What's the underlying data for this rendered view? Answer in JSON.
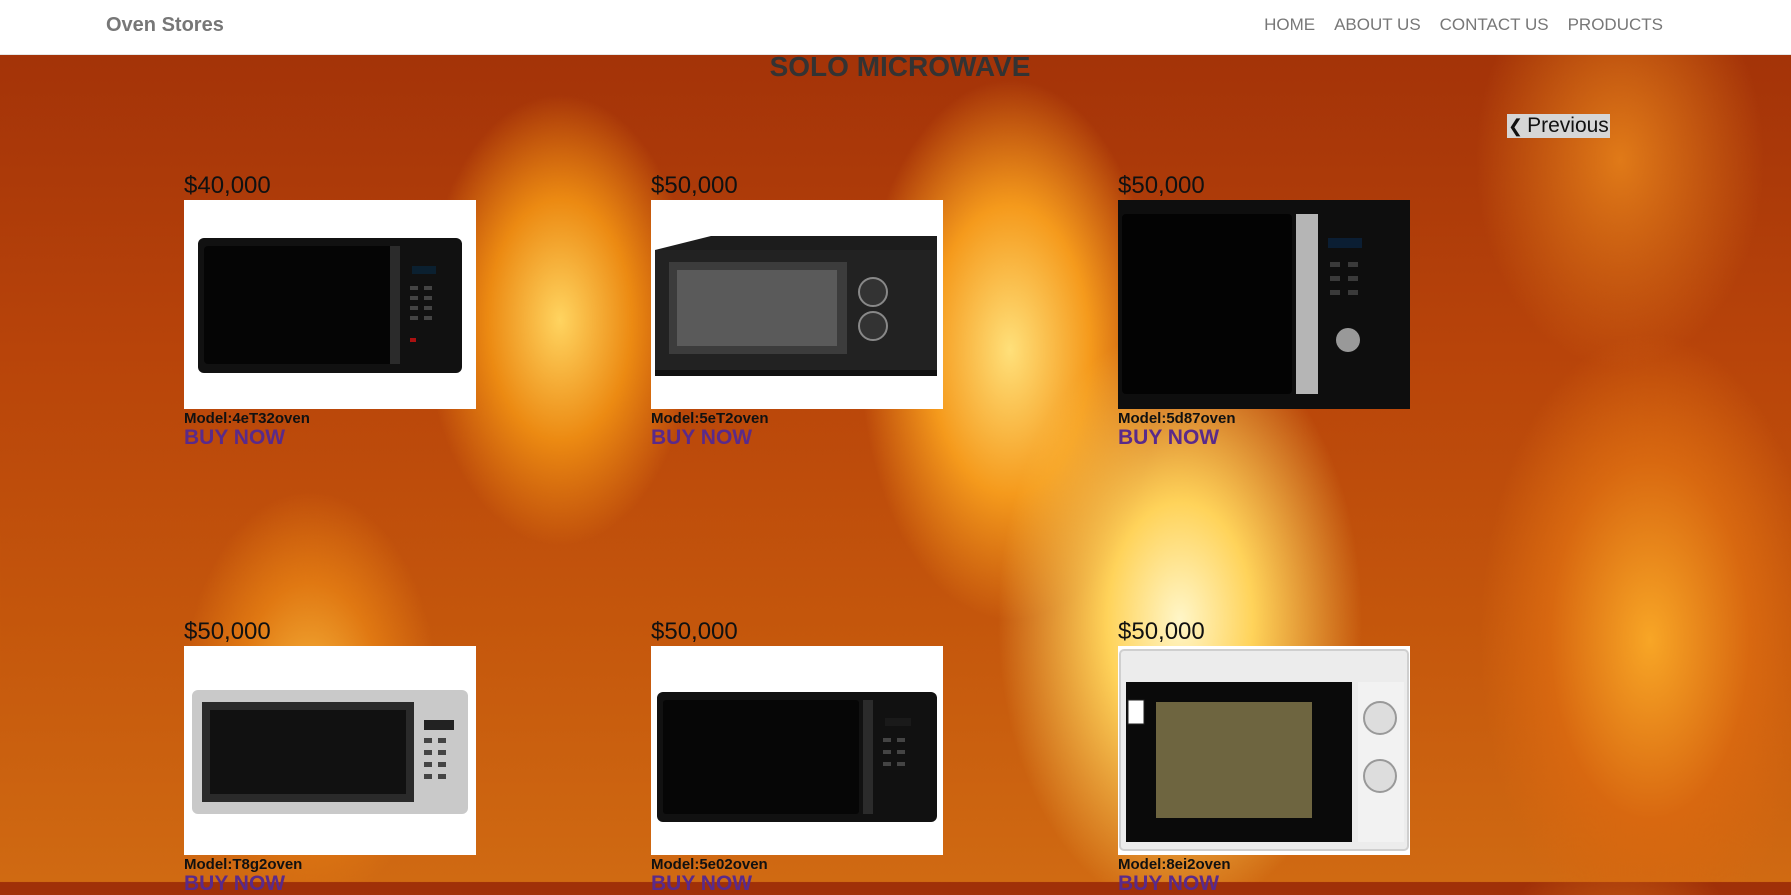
{
  "navbar": {
    "brand": "Oven Stores",
    "links": [
      "HOME",
      "ABOUT US",
      "CONTACT US",
      "PRODUCTS"
    ]
  },
  "page": {
    "title": "SOLO MICROWAVE",
    "previous_label": "Previous"
  },
  "products": [
    {
      "price": "$40,000",
      "model": "Model:4eT32oven",
      "buy": "BUY NOW",
      "image": "black-microwave-icon"
    },
    {
      "price": "$50,000",
      "model": "Model:5eT2oven",
      "buy": "BUY NOW",
      "image": "black-dial-microwave-icon"
    },
    {
      "price": "$50,000",
      "model": "Model:5d87oven",
      "buy": "BUY NOW",
      "image": "black-silver-microwave-icon"
    },
    {
      "price": "$50,000",
      "model": "Model:T8g2oven",
      "buy": "BUY NOW",
      "image": "silver-microwave-icon"
    },
    {
      "price": "$50,000",
      "model": "Model:5e02oven",
      "buy": "BUY NOW",
      "image": "black-microwave-icon"
    },
    {
      "price": "$50,000",
      "model": "Model:8ei2oven",
      "buy": "BUY NOW",
      "image": "white-microwave-icon"
    }
  ],
  "colors": {
    "buy_link": "#5a2a8a",
    "navbar_text": "#777777",
    "background": "#c4560c"
  }
}
